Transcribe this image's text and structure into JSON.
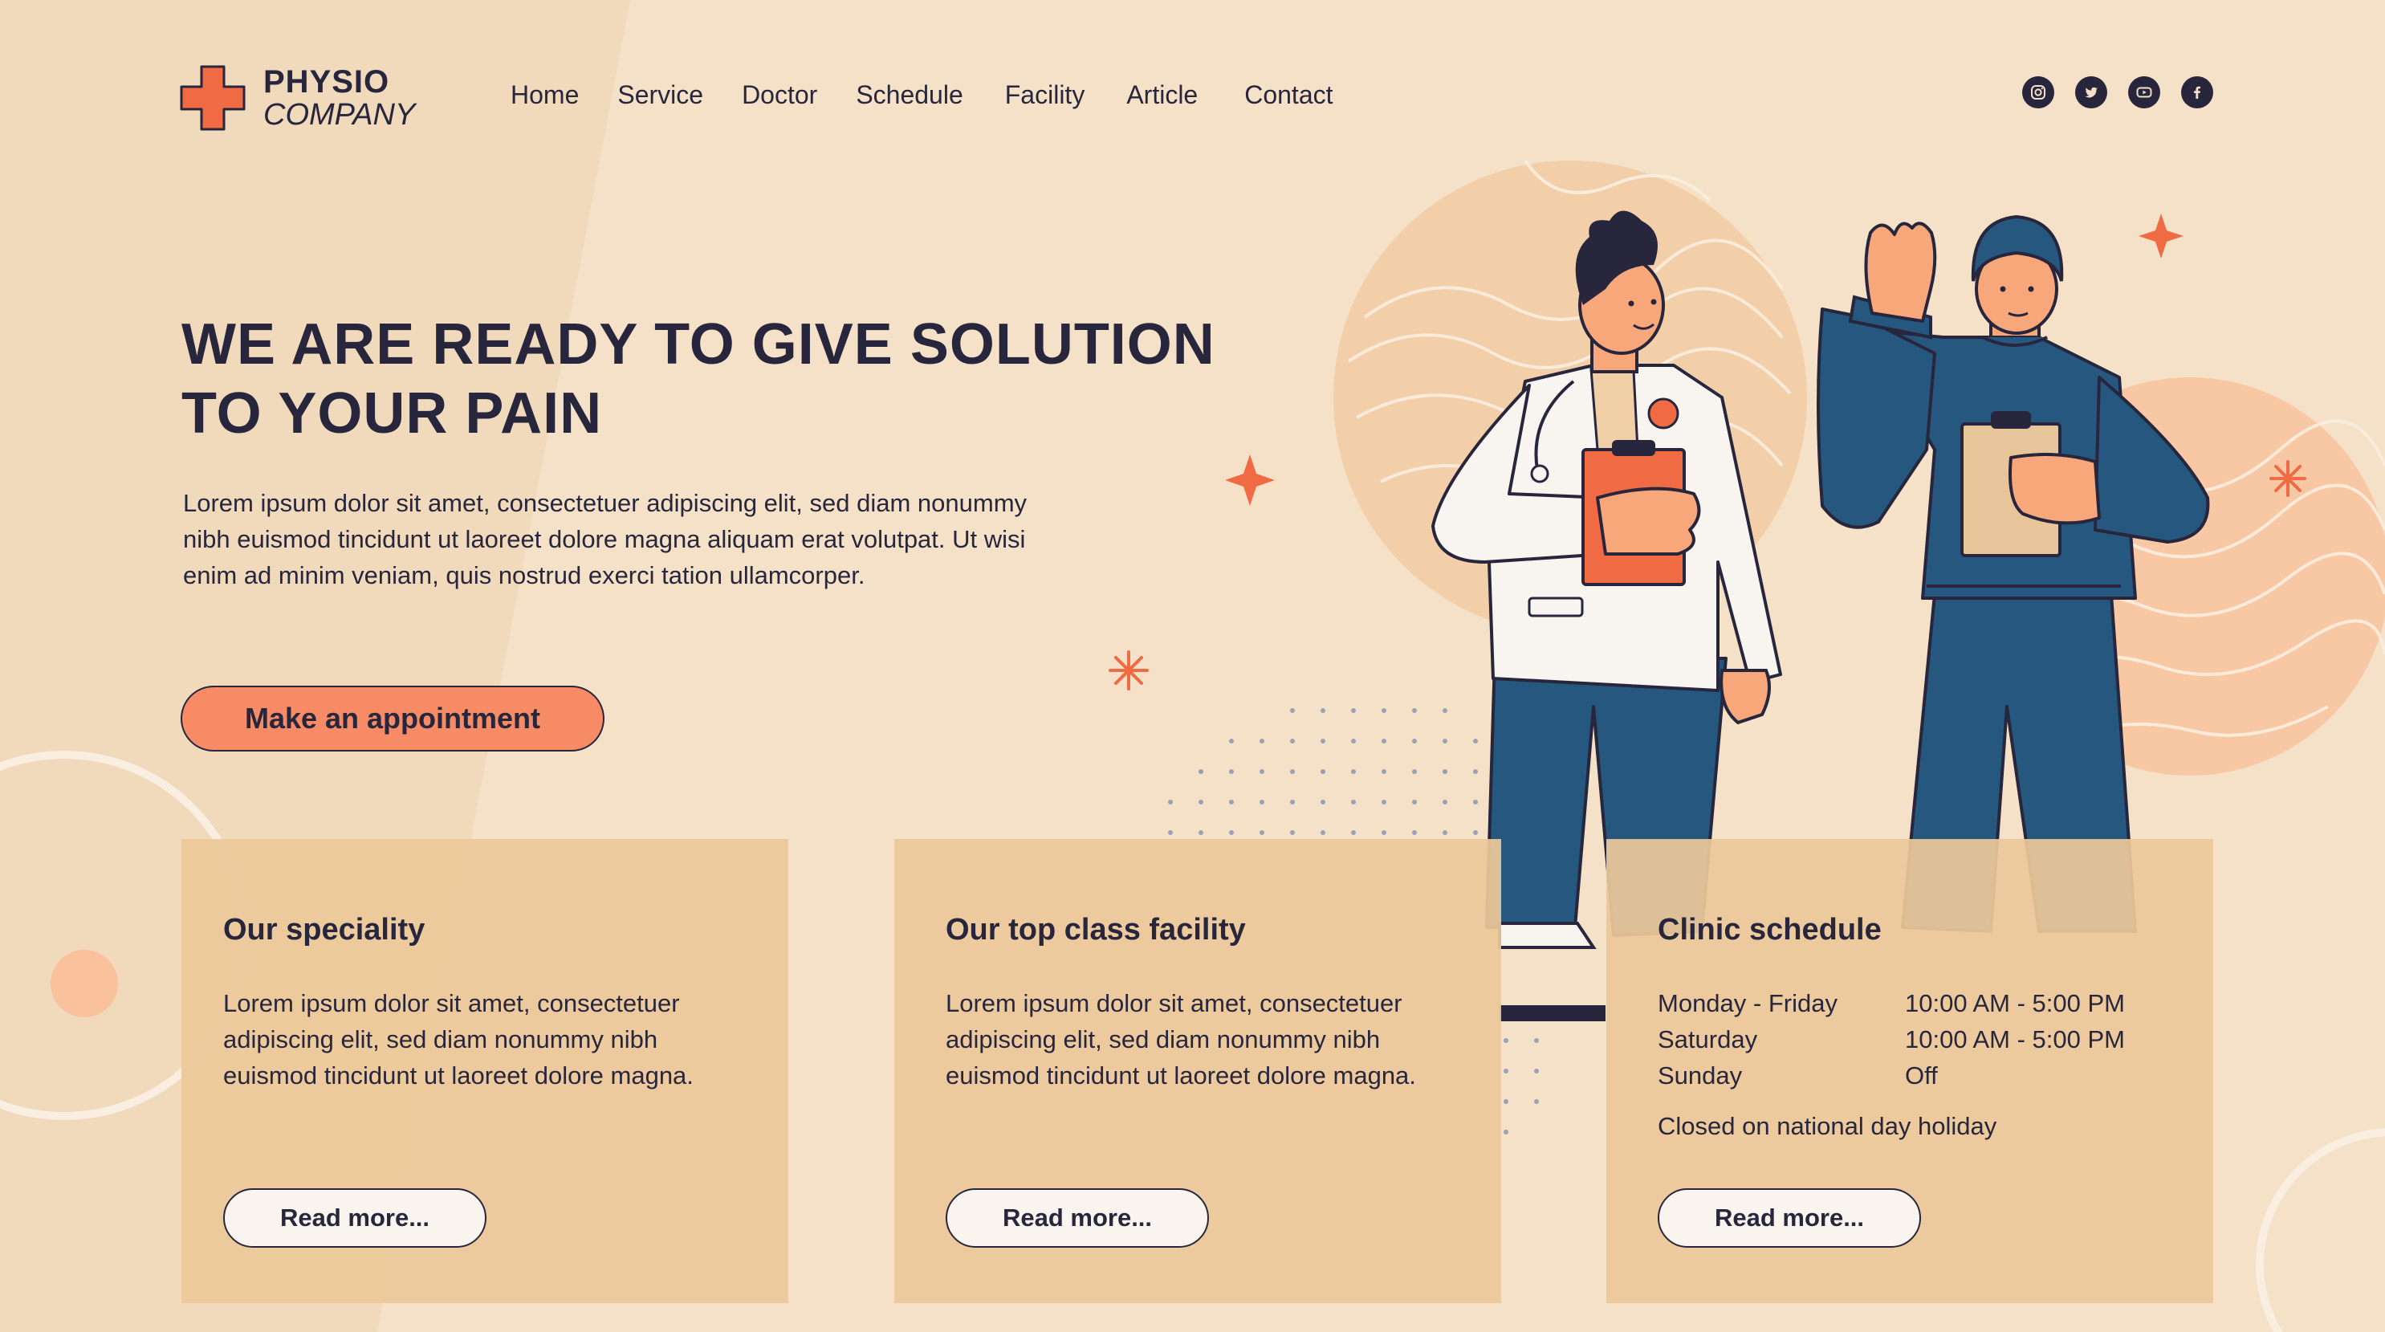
{
  "brand": {
    "line1": "PHYSIO",
    "line2": "COMPANY",
    "accent_color": "#f06a44",
    "text_color": "#27263d",
    "background_color": "#f4e1c7"
  },
  "nav": {
    "items": [
      "Home",
      "Service",
      "Doctor",
      "Schedule",
      "Facility",
      "Article",
      "Contact"
    ]
  },
  "social": {
    "icons": [
      "instagram-icon",
      "twitter-icon",
      "youtube-icon",
      "facebook-icon"
    ]
  },
  "hero": {
    "title_line1": "WE ARE READY TO GIVE SOLUTION",
    "title_line2": "TO YOUR PAIN",
    "description": "Lorem ipsum dolor sit amet, consectetuer adipiscing elit, sed diam nonummy nibh euismod tincidunt ut laoreet dolore magna aliquam erat volutpat. Ut wisi enim ad minim veniam, quis nostrud exerci tation ullamcorper.",
    "cta_label": "Make an appointment"
  },
  "cards": [
    {
      "title": "Our speciality",
      "text": "Lorem ipsum dolor sit amet, consectetuer adipiscing elit, sed diam nonummy nibh euismod tincidunt ut laoreet dolore magna.",
      "button": "Read more..."
    },
    {
      "title": "Our top class facility",
      "text": "Lorem ipsum dolor sit amet, consectetuer adipiscing elit, sed diam nonummy nibh euismod tincidunt ut laoreet dolore magna.",
      "button": "Read more..."
    },
    {
      "title": "Clinic schedule",
      "schedule": [
        {
          "day": "Monday - Friday",
          "hours": "10:00 AM - 5:00 PM"
        },
        {
          "day": "Saturday",
          "hours": "10:00 AM - 5:00 PM"
        },
        {
          "day": "Sunday",
          "hours": "Off"
        }
      ],
      "note": "Closed on national day holiday",
      "button": "Read more..."
    }
  ]
}
